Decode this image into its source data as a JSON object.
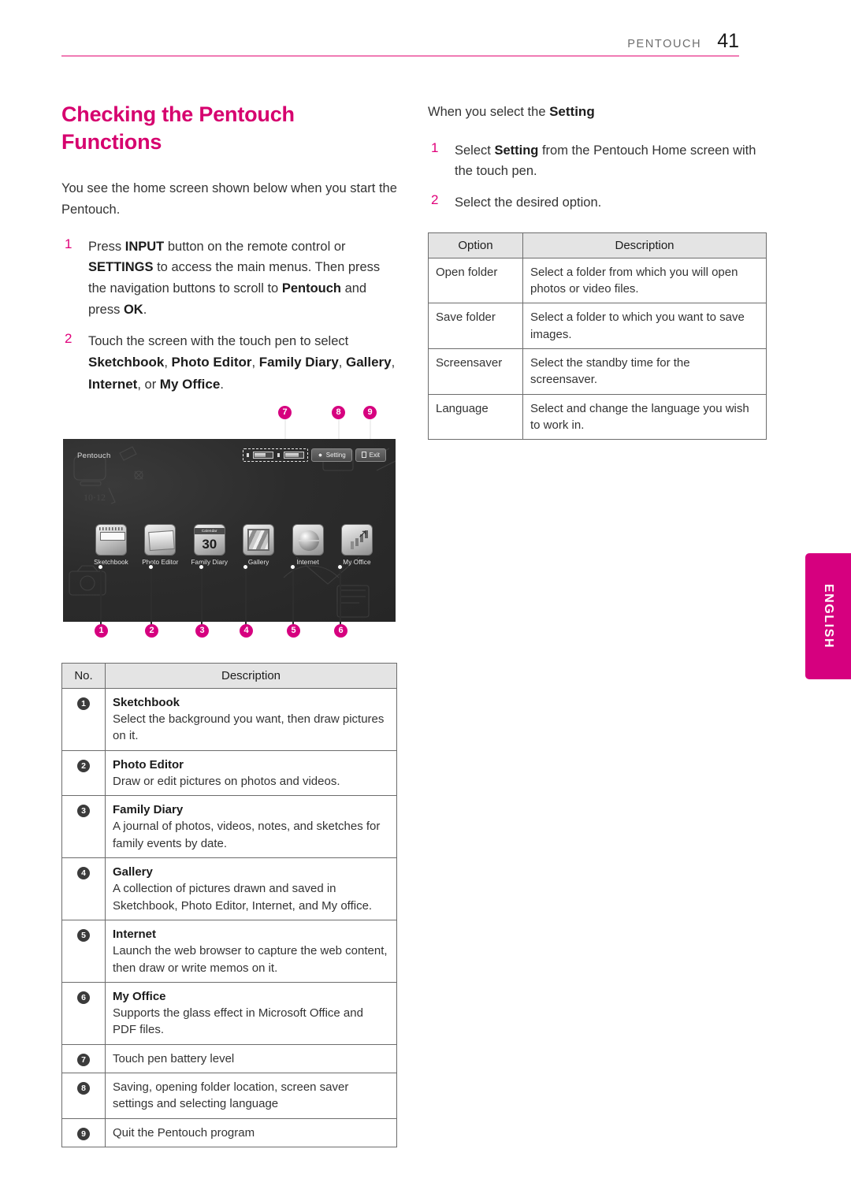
{
  "header": {
    "label": "PENTOUCH",
    "page": "41"
  },
  "left": {
    "title": "Checking the Pentouch Functions",
    "intro": "You see the home screen shown below when you start the Pentouch.",
    "steps": [
      {
        "num": "1",
        "parts": "Press INPUT button on the remote control or SETTINGS to access the main menus. Then press the navigation buttons to scroll to Pentouch and press OK."
      },
      {
        "num": "2",
        "parts": "Touch the screen with the touch pen to select Sketchbook, Photo Editor, Family Diary, Gallery, Internet, or My Office."
      }
    ],
    "step1": {
      "num": "1",
      "t1": "Press ",
      "b1": "INPUT",
      "t2": " button on the remote control or ",
      "b2": "SETTINGS",
      "t3": " to access the main menus. Then press the navigation buttons to scroll to ",
      "b3": "Pentouch",
      "t4": " and press ",
      "b4": "OK",
      "t5": "."
    },
    "step2": {
      "num": "2",
      "t1": "Touch the screen with the touch pen to select ",
      "b1": "Sketchbook",
      "t2": ", ",
      "b2": "Photo Editor",
      "t3": ", ",
      "b3": "Family Diary",
      "t4": ", ",
      "b4": "Gallery",
      "t5": ", ",
      "b5": "Internet",
      "t6": ", or ",
      "b6": "My Office",
      "t7": "."
    }
  },
  "screenshot": {
    "window_title": "Pentouch",
    "setting_button": "Setting",
    "exit_button": "Exit",
    "apps": [
      {
        "label": "Sketchbook"
      },
      {
        "label": "Photo Editor"
      },
      {
        "label": "Family Diary"
      },
      {
        "label": "Gallery"
      },
      {
        "label": "Internet"
      },
      {
        "label": "My Office"
      }
    ],
    "calendar_icon": {
      "header": "Calendar",
      "day": "30"
    },
    "callouts_bottom": [
      "1",
      "2",
      "3",
      "4",
      "5",
      "6"
    ],
    "callouts_top": [
      "7",
      "8",
      "9"
    ]
  },
  "left_table": {
    "headers": [
      "No.",
      "Description"
    ],
    "rows": [
      {
        "no": "1",
        "title": "Sketchbook",
        "desc": "Select the background you want, then draw pictures on it."
      },
      {
        "no": "2",
        "title": "Photo Editor",
        "desc": "Draw or edit pictures on photos and videos."
      },
      {
        "no": "3",
        "title": "Family Diary",
        "desc": "A journal of photos, videos, notes, and sketches for family events by date."
      },
      {
        "no": "4",
        "title": "Gallery",
        "desc": "A collection of pictures drawn and saved in Sketchbook, Photo Editor, Internet, and My office."
      },
      {
        "no": "5",
        "title": "Internet",
        "desc": "Launch the web browser to capture the web content, then draw or write memos on it."
      },
      {
        "no": "6",
        "title": "My Office",
        "desc": "Supports the glass effect in Microsoft Office and PDF files."
      },
      {
        "no": "7",
        "title": "",
        "desc": "Touch pen battery level"
      },
      {
        "no": "8",
        "title": "",
        "desc": "Saving, opening folder location, screen saver settings and selecting language"
      },
      {
        "no": "9",
        "title": "",
        "desc": "Quit the Pentouch program"
      }
    ]
  },
  "right": {
    "lead_plain": "When you select the ",
    "lead_bold": "Setting",
    "step1": {
      "num": "1",
      "t1": "Select ",
      "b1": "Setting",
      "t2": " from the Pentouch Home screen with the touch pen."
    },
    "step2": {
      "num": "2",
      "t1": "Select the desired option."
    }
  },
  "right_table": {
    "headers": [
      "Option",
      "Description"
    ],
    "rows": [
      {
        "option": "Open folder",
        "desc": "Select a folder from which you will open photos or video files."
      },
      {
        "option": "Save folder",
        "desc": "Select a folder to which you want to save images."
      },
      {
        "option": "Screensaver",
        "desc": "Select the standby time for the screensaver."
      },
      {
        "option": "Language",
        "desc": "Select and change the language you wish to work in."
      }
    ]
  },
  "side_tab": {
    "label": "ENGLISH"
  },
  "colors": {
    "accent": "#d6007f",
    "rule": "#f07cb4",
    "header_gray": "#e4e4e4"
  }
}
